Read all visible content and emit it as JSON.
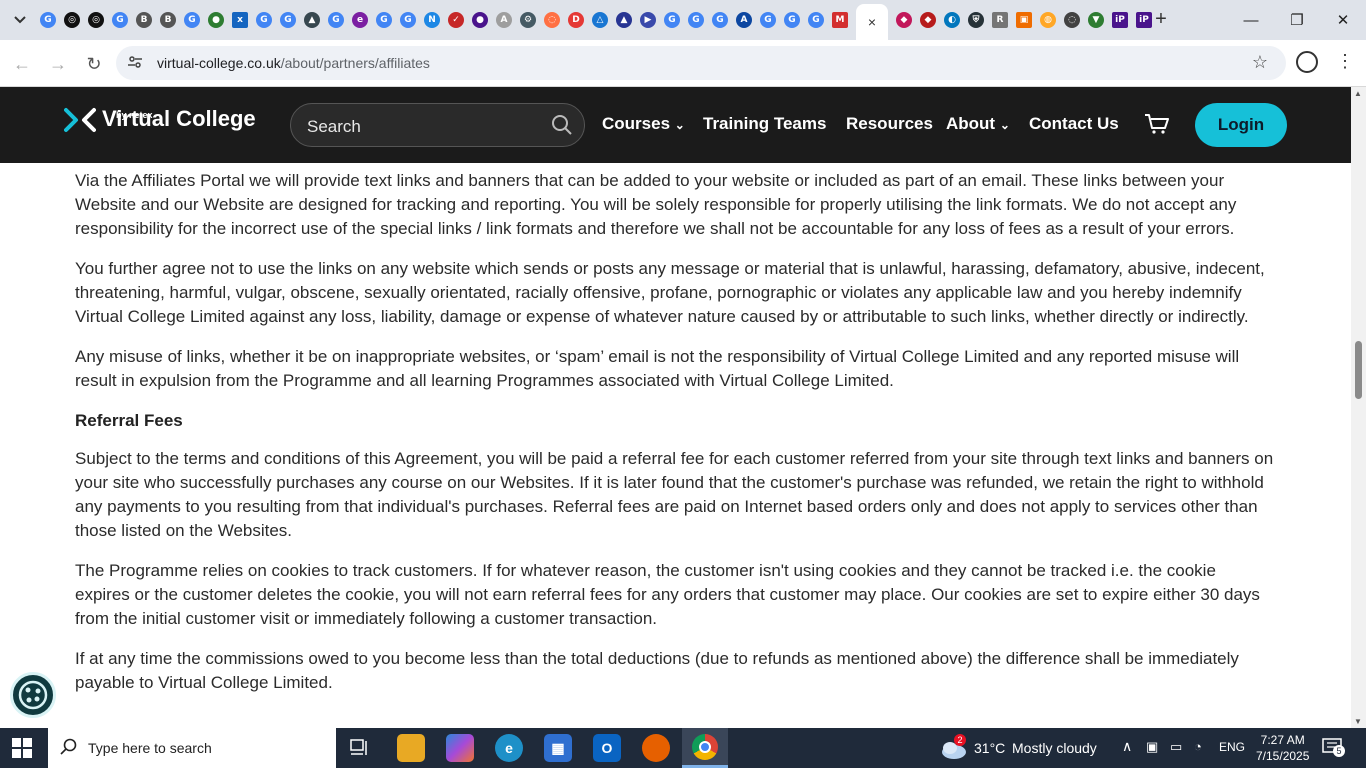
{
  "browser": {
    "tab_list_icon": "chevron-down-icon",
    "active_tab_close": "×",
    "new_tab": "+",
    "window_controls": {
      "minimize": "—",
      "restore": "❐",
      "close": "✕"
    },
    "url_host": "virtual-college.co.uk",
    "url_path": "/about/partners/affiliates",
    "back": "←",
    "forward": "→",
    "reload": "↻",
    "bookmark_icon": "star-icon",
    "menu": "⋮"
  },
  "site": {
    "logo_name": "Virtual College",
    "logo_sub": "by netex",
    "search_placeholder": "Search",
    "nav": {
      "courses": "Courses",
      "training_teams": "Training Teams",
      "resources": "Resources",
      "about": "About",
      "contact": "Contact Us"
    },
    "login": "Login",
    "colors": {
      "accent": "#16c0d8",
      "header_bg": "#1b1b1b"
    }
  },
  "content": {
    "p1": "Via the Affiliates Portal we will provide text links and banners that can be added to your website or included as part of an email. These links between your Website and our Website are designed for tracking and reporting. You will be solely responsible for properly utilising the link formats. We do not accept any responsibility for the incorrect use of the special links / link formats and therefore we shall not be accountable for any loss of fees as a result of your errors.",
    "p2": "You further agree not to use the links on any website which sends or posts any message or material that is unlawful, harassing, defamatory, abusive, indecent, threatening, harmful, vulgar, obscene, sexually orientated, racially offensive, profane, pornographic or violates any applicable law and you hereby indemnify Virtual College Limited against any loss, liability, damage or expense of whatever nature caused by or attributable to such links, whether directly or indirectly.",
    "p3": "Any misuse of links, whether it be on inappropriate websites, or ‘spam’ email is not the responsibility of Virtual College Limited and any reported misuse will result in expulsion from the Programme and all learning Programmes associated with Virtual College Limited.",
    "heading_referral": "Referral Fees",
    "p4": "Subject to the terms and conditions of this Agreement, you will be paid a referral fee for each customer referred from your site through text links and banners on your site who successfully purchases any course on our Websites. If it is later found that the customer's purchase was refunded, we retain the right to withhold any payments to you resulting from that individual's purchases. Referral fees are paid on Internet based orders only and does not apply to services other than those listed on the Websites.",
    "p5": "The Programme relies on cookies to track customers. If for whatever reason, the customer isn't using cookies and they cannot be tracked i.e. the cookie expires or the customer deletes the cookie, you will not earn referral fees for any orders that customer may place. Our cookies are set to expire either 30 days from the initial customer visit or immediately following a customer transaction.",
    "p6": "If at any time the commissions owed to you become less than the total deductions (due to refunds as mentioned above) the difference shall be immediately payable to Virtual College Limited."
  },
  "taskbar": {
    "search_placeholder": "Type here to search",
    "weather_temp": "31°C",
    "weather_desc": "Mostly cloudy",
    "weather_badge": "2",
    "language": "ENG",
    "time": "7:27 AM",
    "date": "7/15/2025",
    "notification_count": "5"
  }
}
